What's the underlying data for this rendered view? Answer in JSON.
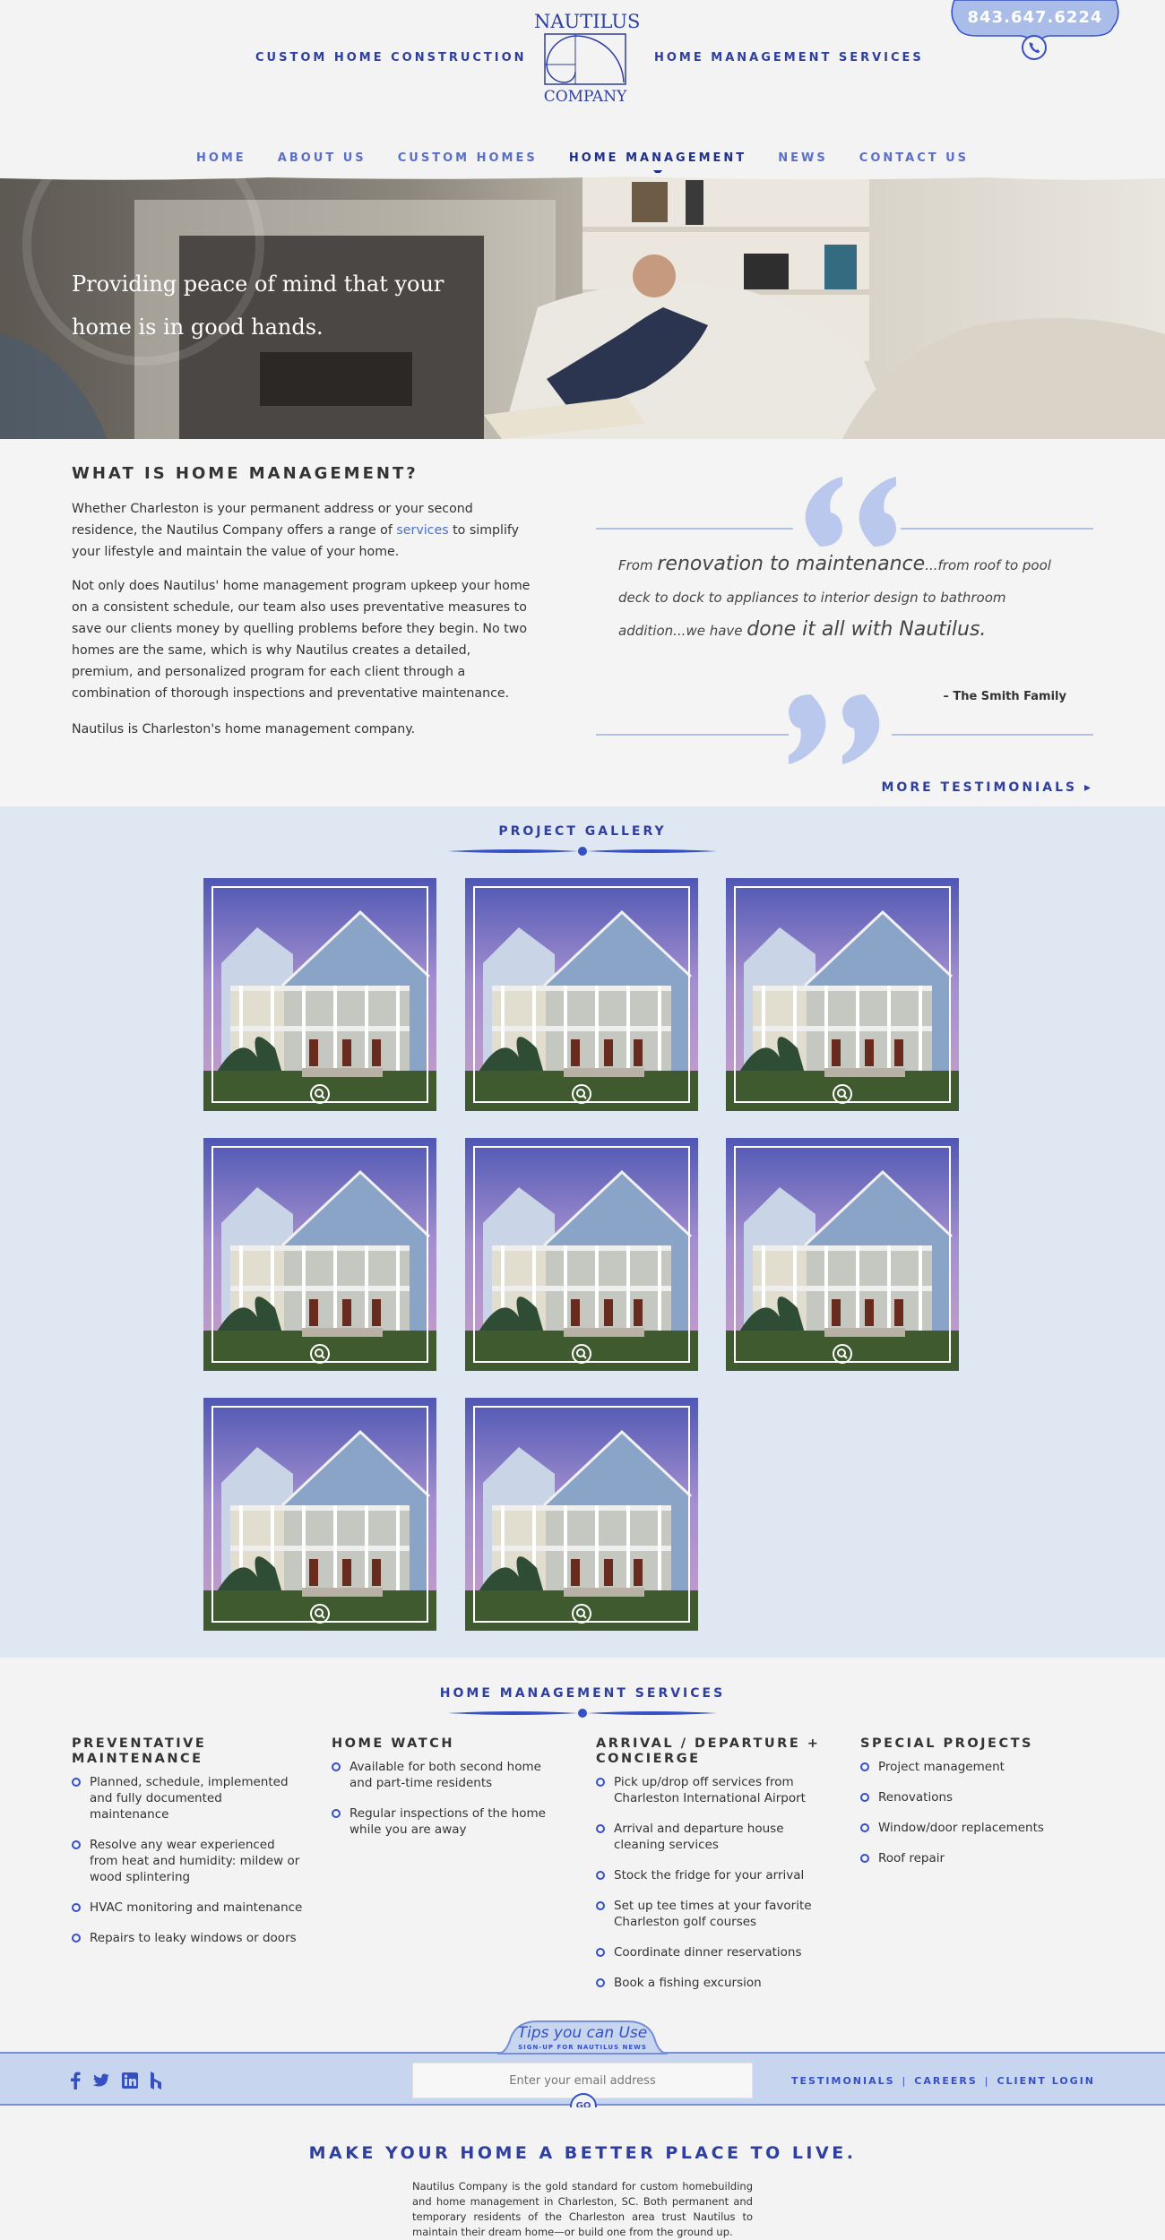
{
  "header": {
    "left_link": "CUSTOM HOME CONSTRUCTION",
    "right_link": "HOME MANAGEMENT SERVICES",
    "logo_line1": "NAUTILUS",
    "logo_line2": "COMPANY",
    "phone": "843.647.6224",
    "phone_icon": "phone-icon"
  },
  "nav": {
    "items": [
      {
        "label": "HOME"
      },
      {
        "label": "ABOUT US"
      },
      {
        "label": "CUSTOM HOMES"
      },
      {
        "label": "HOME MANAGEMENT"
      },
      {
        "label": "NEWS"
      },
      {
        "label": "CONTACT US"
      }
    ],
    "active": "HOME MANAGEMENT"
  },
  "hero": {
    "tagline": "Providing peace of mind that your home is in good hands."
  },
  "about": {
    "title": "WHAT IS HOME MANAGEMENT?",
    "p1_before": "Whether Charleston is your permanent address or your second residence, the Nautilus Company offers a range of ",
    "p1_link": "services",
    "p1_after": " to simplify your lifestyle and maintain the value of your home.",
    "p2": "Not only does Nautilus' home management program upkeep your home on a consistent schedule, our team also uses preventative measures to save our clients money by quelling problems before they begin. No two homes are the same, which is why Nautilus creates a detailed, premium, and personalized program for each client through a combination of thorough inspections and preventative maintenance.",
    "p3": "Nautilus is Charleston's home management company."
  },
  "testimonial": {
    "q1": "From ",
    "q2": "renovation to maintenance",
    "q3": "...from roof to pool deck to dock to appliances to interior design to bathroom addition...we have ",
    "q4": "done it all with Nautilus",
    "q5": ".",
    "author": "– The Smith Family",
    "more": "MORE TESTIMONIALS"
  },
  "gallery": {
    "title": "PROJECT GALLERY",
    "tile_count": 8,
    "zoom_icon": "zoom-icon"
  },
  "services": {
    "title": "HOME MANAGEMENT SERVICES",
    "columns": [
      {
        "heading": "PREVENTATIVE MAINTENANCE",
        "items": [
          "Planned, schedule, implemented and fully documented maintenance",
          "Resolve any wear experienced from heat and humidity: mildew or wood splintering",
          "HVAC monitoring and maintenance",
          "Repairs to leaky windows or doors"
        ]
      },
      {
        "heading": "HOME WATCH",
        "items": [
          "Available for both second home and part-time residents",
          "Regular inspections of the home while you are away"
        ]
      },
      {
        "heading": "ARRIVAL / DEPARTURE + CONCIERGE",
        "items": [
          "Pick up/drop off services from Charleston International Airport",
          "Arrival and departure house cleaning services",
          "Stock the fridge for your arrival",
          "Set up tee times at your favorite Charleston golf courses",
          "Coordinate dinner reservations",
          "Book a fishing excursion"
        ]
      },
      {
        "heading": "SPECIAL PROJECTS",
        "items": [
          "Project management",
          "Renovations",
          "Window/door replacements",
          "Roof repair"
        ]
      }
    ]
  },
  "newsletter": {
    "title": "Tips you can Use",
    "subtitle": "SIGN-UP FOR NAUTILUS NEWS",
    "placeholder": "Enter your email address",
    "go": "GO"
  },
  "social": [
    "facebook-icon",
    "twitter-icon",
    "linkedin-icon",
    "houzz-icon"
  ],
  "footer_links": [
    "TESTIMONIALS",
    "CAREERS",
    "CLIENT LOGIN"
  ],
  "footer_sep": "|",
  "bottom": {
    "title": "MAKE YOUR HOME A BETTER PLACE TO LIVE.",
    "text": "Nautilus Company is the gold standard for custom homebuilding and home management in Charleston, SC. Both permanent and temporary residents of the Charleston area trust Nautilus to maintain their dream home—or build one from the ground up."
  },
  "colors": {
    "brand_blue": "#2e3f9e",
    "accent_blue": "#3550c4",
    "gallery_bg": "#dfe7f3"
  }
}
